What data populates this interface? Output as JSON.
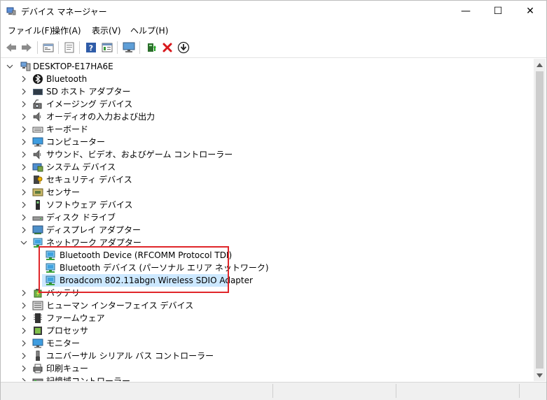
{
  "window": {
    "title": "デバイス マネージャー",
    "minimize_glyph": "—",
    "maximize_glyph": "☐",
    "close_glyph": "✕"
  },
  "menu": [
    {
      "label": "ファイル(F)"
    },
    {
      "label": "操作(A)"
    },
    {
      "label": "表示(V)"
    },
    {
      "label": "ヘルプ(H)"
    }
  ],
  "toolbar": {
    "icons": [
      "back-arrow-icon",
      "forward-arrow-icon",
      "device-properties-icon",
      "show-hide-icon",
      "help-icon",
      "view-icon",
      "monitor-icon",
      "update-driver-icon",
      "uninstall-icon",
      "download-icon"
    ]
  },
  "tree": {
    "root": {
      "label": "DESKTOP-E17HA6E",
      "icon": "computer-root-icon"
    },
    "categories": [
      {
        "label": "Bluetooth",
        "icon": "bluetooth-icon",
        "expanded": false
      },
      {
        "label": "SD ホスト アダプター",
        "icon": "sd-host-icon",
        "expanded": false
      },
      {
        "label": "イメージング デバイス",
        "icon": "camera-icon",
        "expanded": false
      },
      {
        "label": "オーディオの入力および出力",
        "icon": "speaker-icon",
        "expanded": false
      },
      {
        "label": "キーボード",
        "icon": "keyboard-icon",
        "expanded": false
      },
      {
        "label": "コンピューター",
        "icon": "computer-icon",
        "expanded": false
      },
      {
        "label": "サウンド、ビデオ、およびゲーム コントローラー",
        "icon": "speaker-icon",
        "expanded": false
      },
      {
        "label": "システム デバイス",
        "icon": "system-device-icon",
        "expanded": false
      },
      {
        "label": "セキュリティ デバイス",
        "icon": "security-key-icon",
        "expanded": false
      },
      {
        "label": "センサー",
        "icon": "sensor-icon",
        "expanded": false
      },
      {
        "label": "ソフトウェア デバイス",
        "icon": "software-device-icon",
        "expanded": false
      },
      {
        "label": "ディスク ドライブ",
        "icon": "disk-drive-icon",
        "expanded": false
      },
      {
        "label": "ディスプレイ アダプター",
        "icon": "display-adapter-icon",
        "expanded": false
      },
      {
        "label": "ネットワーク アダプター",
        "icon": "network-adapter-icon",
        "expanded": true,
        "children": [
          {
            "label": "Bluetooth Device (RFCOMM Protocol TDI)",
            "icon": "network-adapter-icon",
            "selected": false
          },
          {
            "label": "Bluetooth デバイス (パーソナル エリア ネットワーク)",
            "icon": "network-adapter-icon",
            "selected": false
          },
          {
            "label": "Broadcom 802.11abgn Wireless SDIO Adapter",
            "icon": "network-adapter-icon",
            "selected": true
          }
        ]
      },
      {
        "label": "バッテリ",
        "icon": "battery-icon",
        "expanded": false
      },
      {
        "label": "ヒューマン インターフェイス デバイス",
        "icon": "hid-icon",
        "expanded": false
      },
      {
        "label": "ファームウェア",
        "icon": "firmware-icon",
        "expanded": false
      },
      {
        "label": "プロセッサ",
        "icon": "processor-icon",
        "expanded": false
      },
      {
        "label": "モニター",
        "icon": "monitor-icon",
        "expanded": false
      },
      {
        "label": "ユニバーサル シリアル バス コントローラー",
        "icon": "usb-icon",
        "expanded": false
      },
      {
        "label": "印刷キュー",
        "icon": "printer-icon",
        "expanded": false
      },
      {
        "label": "記憶域コントローラー",
        "icon": "storage-controller-icon",
        "expanded": false
      }
    ]
  },
  "colors": {
    "selection": "#cce8ff",
    "highlight_border": "#e0262a",
    "chevron": "#444444"
  }
}
